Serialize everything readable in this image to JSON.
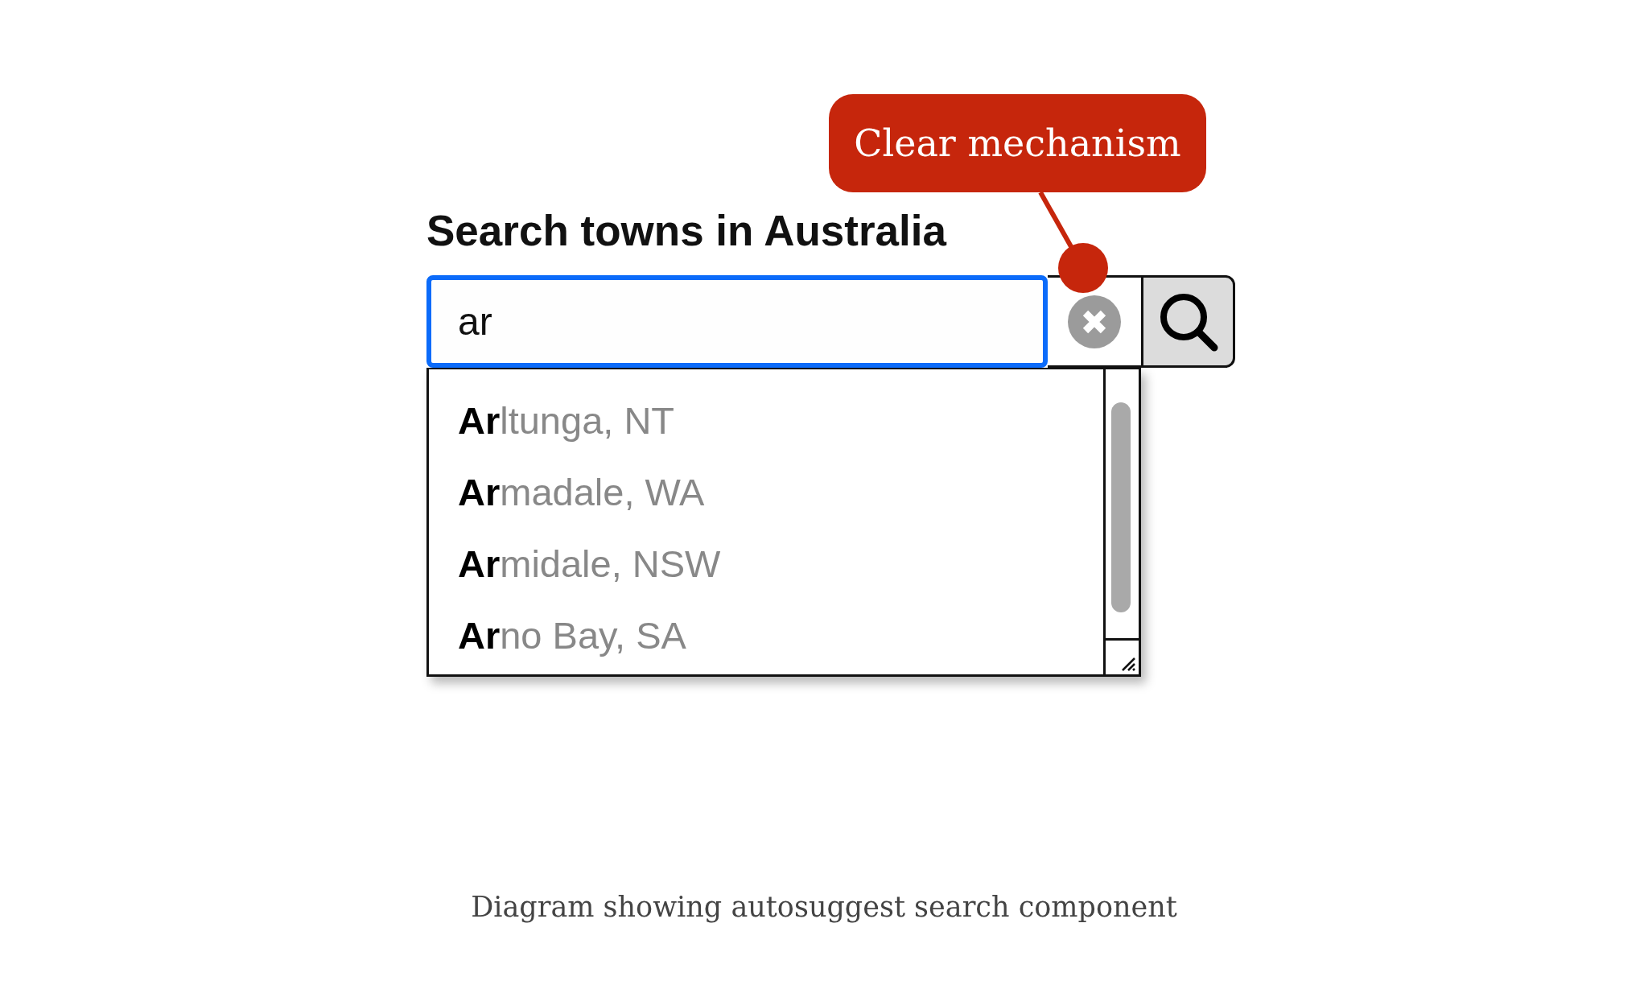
{
  "callout": {
    "label": "Clear mechanism"
  },
  "search": {
    "label": "Search towns in Australia",
    "value": "ar",
    "focused": true
  },
  "suggestions": [
    {
      "text": "**Ar**ltunga, NT"
    },
    {
      "text": "**Ar**madale, WA"
    },
    {
      "text": "**Ar**midale, NSW"
    },
    {
      "text": "**Ar**no Bay, SA"
    }
  ],
  "caption": "Diagram showing autosuggest search component"
}
